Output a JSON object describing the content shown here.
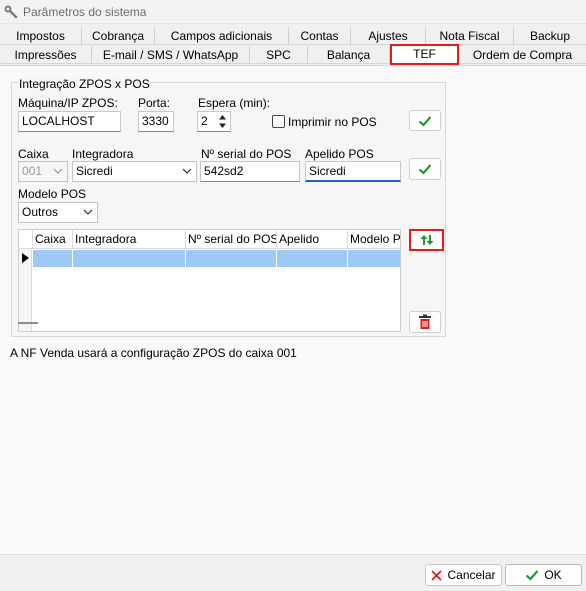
{
  "window": {
    "title": "Parâmetros do sistema"
  },
  "tabs_row1": [
    "Impostos",
    "Cobrança",
    "Campos adicionais",
    "Contas",
    "Ajustes",
    "Nota Fiscal",
    "Backup"
  ],
  "tabs_row2": [
    "Impressões",
    "E-mail / SMS / WhatsApp",
    "SPC",
    "Balança",
    "TEF",
    "Ordem de Compra"
  ],
  "active_tab": "TEF",
  "group": {
    "title": "Integração ZPOS x POS",
    "maquina_label": "Máquina/IP ZPOS:",
    "maquina_value": "LOCALHOST",
    "porta_label": "Porta:",
    "porta_value": "3330",
    "espera_label": "Espera (min):",
    "espera_value": "2",
    "imprimir_label": "Imprimir no POS",
    "imprimir_checked": false,
    "caixa_label": "Caixa",
    "caixa_value": "001",
    "integradora_label": "Integradora",
    "integradora_value": "Sicredi",
    "serial_label": "Nº serial do POS",
    "serial_value": "542sd2",
    "apelido_label": "Apelido POS",
    "apelido_value": "Sicredi",
    "modelo_label": "Modelo POS",
    "modelo_value": "Outros"
  },
  "grid": {
    "columns": [
      "Caixa",
      "Integradora",
      "Nº serial do POS",
      "Apelido",
      "Modelo PC"
    ],
    "rows": [
      [
        "",
        "",
        "",
        "",
        ""
      ]
    ]
  },
  "footer_message": "A NF Venda usará a configuração ZPOS do caixa 001",
  "buttons": {
    "cancel": "Cancelar",
    "ok": "OK"
  },
  "colors": {
    "accent_green": "#1c9a3a",
    "highlight_red": "#e21c1c",
    "selection_blue": "#9ec9f5",
    "delete_red": "#d42020"
  }
}
